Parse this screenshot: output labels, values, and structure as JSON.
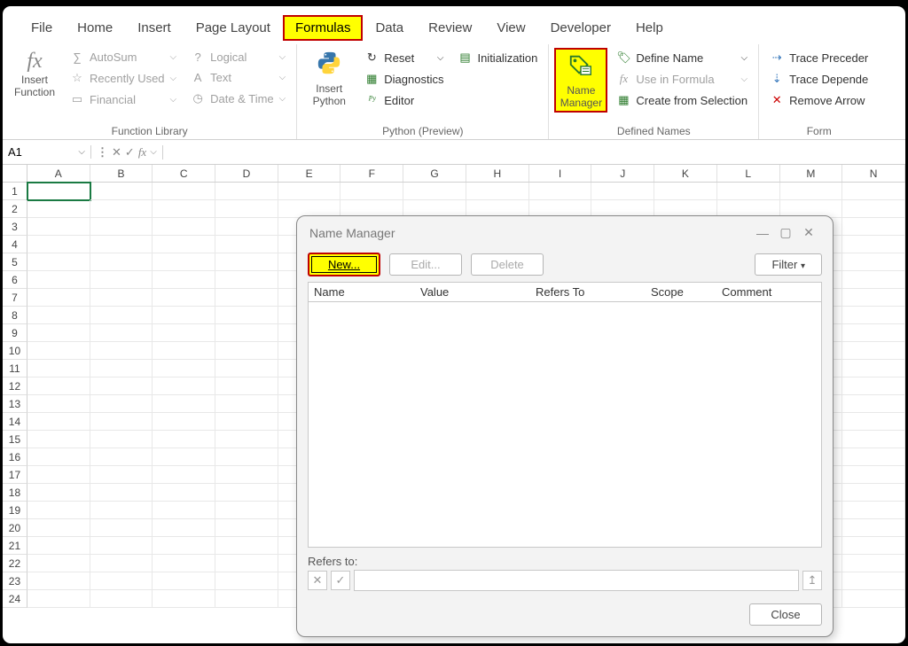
{
  "tabs": {
    "file": "File",
    "home": "Home",
    "insert": "Insert",
    "pagelayout": "Page Layout",
    "formulas": "Formulas",
    "data": "Data",
    "review": "Review",
    "view": "View",
    "developer": "Developer",
    "help": "Help"
  },
  "ribbon": {
    "function_library": {
      "label": "Function Library",
      "insert_function": "Insert\nFunction",
      "autosum": "AutoSum",
      "recently": "Recently Used",
      "financial": "Financial",
      "logical": "Logical",
      "text": "Text",
      "datetime": "Date & Time"
    },
    "python": {
      "label": "Python (Preview)",
      "insert_python": "Insert\nPython",
      "reset": "Reset",
      "diagnostics": "Diagnostics",
      "editor": "Editor",
      "initialization": "Initialization"
    },
    "defined_names": {
      "label": "Defined Names",
      "name_manager": "Name\nManager",
      "define_name": "Define Name",
      "use_in_formula": "Use in Formula",
      "create_selection": "Create from Selection"
    },
    "auditing": {
      "label": "Form",
      "trace_prec": "Trace Preceder",
      "trace_dep": "Trace Depende",
      "remove_arrow": "Remove Arrow"
    }
  },
  "formula_bar": {
    "name_box": "A1"
  },
  "columns": [
    "A",
    "B",
    "C",
    "D",
    "E",
    "F",
    "G",
    "H",
    "I",
    "J",
    "K",
    "L",
    "M",
    "N"
  ],
  "row_count": 24,
  "dialog": {
    "title": "Name Manager",
    "new": "New...",
    "edit": "Edit...",
    "delete": "Delete",
    "filter": "Filter",
    "cols": {
      "name": "Name",
      "value": "Value",
      "refers": "Refers To",
      "scope": "Scope",
      "comment": "Comment"
    },
    "refers_label": "Refers to:",
    "close": "Close"
  }
}
